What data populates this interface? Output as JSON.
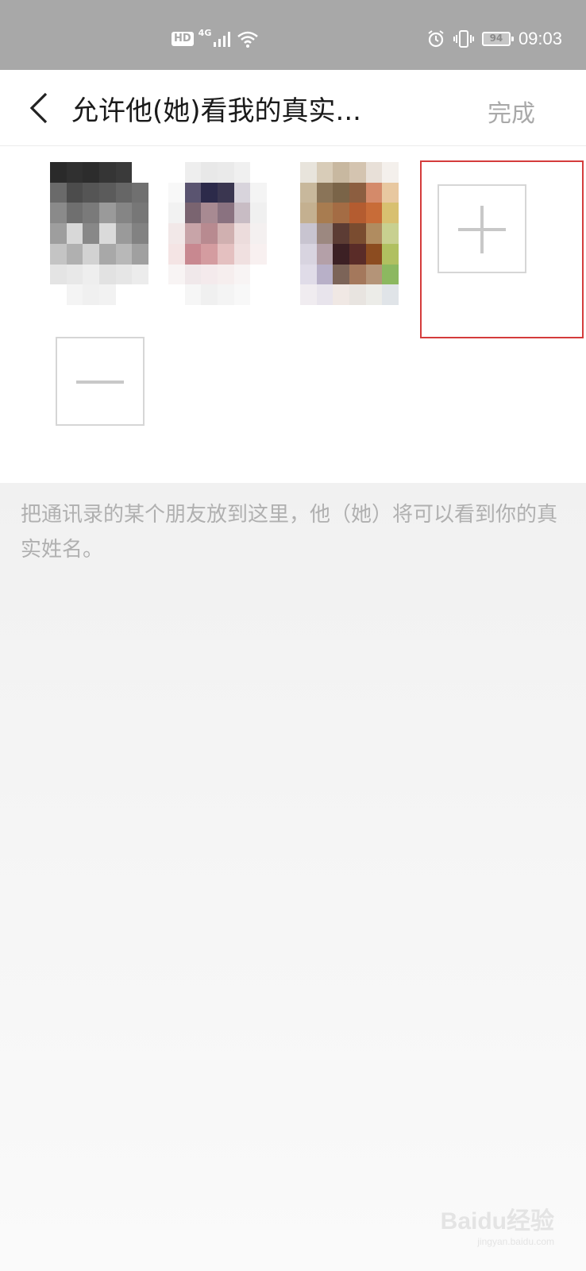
{
  "status_bar": {
    "hd": "HD",
    "network": "4G",
    "battery": "94",
    "time": "09:03"
  },
  "header": {
    "title": "允许他(她)看我的真实...",
    "done_label": "完成"
  },
  "members": [
    {
      "icon": "blurred-avatar"
    },
    {
      "icon": "blurred-avatar"
    },
    {
      "icon": "blurred-avatar"
    }
  ],
  "actions": {
    "add_icon": "plus-icon",
    "remove_icon": "minus-icon",
    "highlight_color": "#d43c3c"
  },
  "hint": "把通讯录的某个朋友放到这里，他（她）将可以看到你的真实姓名。",
  "watermark": {
    "brand": "Baidu经验",
    "url": "jingyan.baidu.com"
  }
}
